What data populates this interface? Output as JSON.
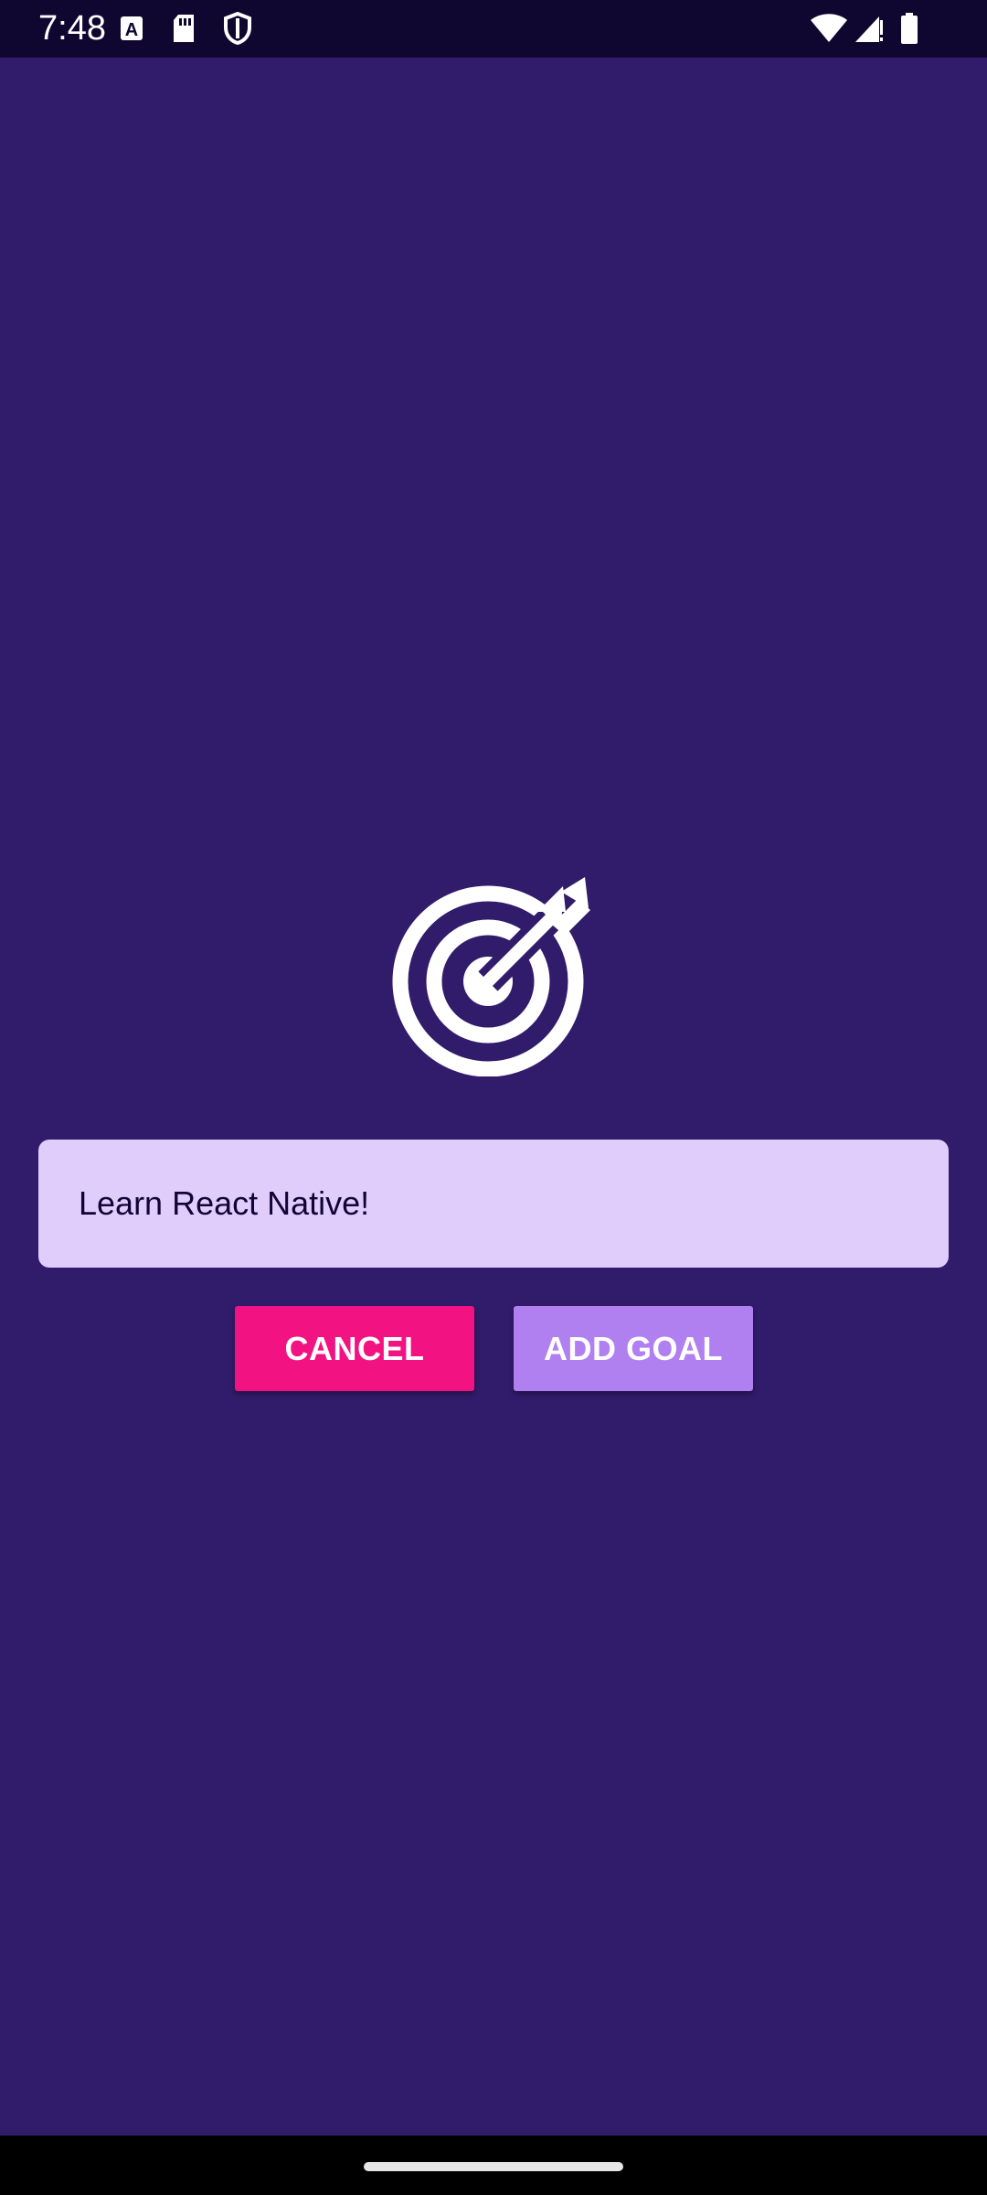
{
  "status_bar": {
    "time": "7:48",
    "left_icons": [
      "text-a-icon",
      "sd-card-icon",
      "shield-icon"
    ],
    "right_icons": [
      "wifi-icon",
      "signal-icon",
      "battery-icon"
    ]
  },
  "goal_form": {
    "input_value": "Learn React Native!",
    "cancel_label": "CANCEL",
    "add_label": "ADD GOAL"
  },
  "colors": {
    "background": "#311b6b",
    "status_bar": "#0f0730",
    "input_background": "#e0cdfb",
    "input_text": "#120438",
    "cancel_button": "#f31282",
    "add_button": "#b180f0"
  }
}
